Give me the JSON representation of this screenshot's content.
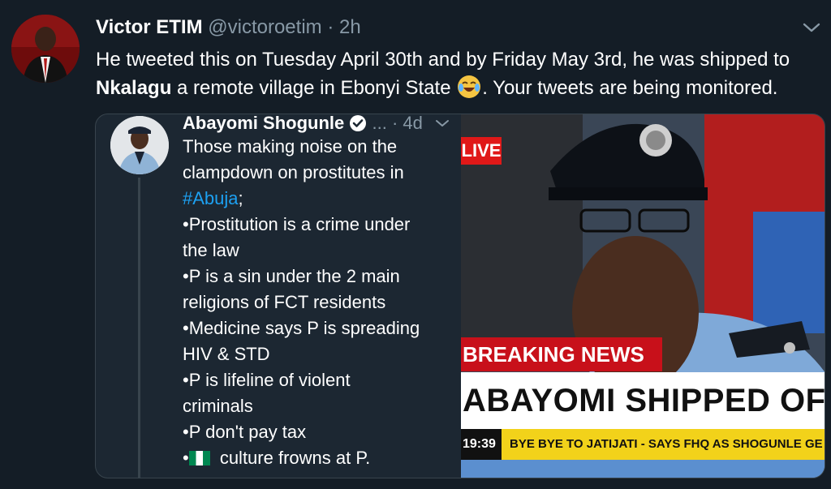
{
  "tweet": {
    "author_name": "Victor ETIM",
    "handle": "@victoroetim",
    "separator": "·",
    "time": "2h",
    "text_part1": "He tweeted this on Tuesday April 30th and by Friday May 3rd, he was shipped to",
    "text_bold": "Nkalagu",
    "text_part2": " a remote village in Ebonyi State ",
    "text_part3": ". Your tweets are being monitored."
  },
  "quoted_tweet": {
    "author_name": "Abayomi Shogunle",
    "more": "...",
    "separator": "·",
    "time": "4d",
    "lines": {
      "l1": "Those making noise on the",
      "l2": "clampdown on prostitutes in",
      "l3_hashtag": "#Abuja",
      "l3_rest": ";",
      "l4": "•Prostitution is a crime under",
      "l5": "the law",
      "l6": "•P is a sin under the 2 main",
      "l7": "religions of FCT residents",
      "l8": "•Medicine says P is spreading",
      "l9": "HIV & STD",
      "l10": "•P is lifeline of violent",
      "l11": "criminals",
      "l12": "•P don't pay tax",
      "l13_bullet": "•",
      "l13_rest": " culture frowns at P."
    }
  },
  "media": {
    "live_label": "LIVE",
    "breaking_label": "BREAKING NEWS",
    "headline": "ABAYOMI SHIPPED OFF",
    "ticker_time": "19:39",
    "ticker_text": "BYE BYE TO JATIJATI - SAYS FHQ AS SHOGUNLE GE"
  },
  "icons": {
    "chevron": "chevron-down-icon",
    "verified": "verified-badge-icon",
    "emoji": "tears-of-joy-emoji-icon",
    "flag": "nigeria-flag-icon"
  },
  "colors": {
    "background": "#141d26",
    "link": "#1da1f2",
    "secondary_text": "#8899a6",
    "breaking_red": "#c8101a",
    "ticker_yellow": "#f2d21a"
  }
}
